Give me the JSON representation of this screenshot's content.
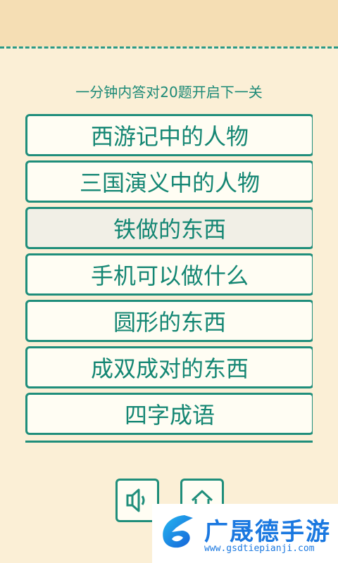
{
  "subtitle": "一分钟内答对20题开启下一关",
  "categories": [
    {
      "label": "西游记中的人物"
    },
    {
      "label": "三国演义中的人物"
    },
    {
      "label": "铁做的东西"
    },
    {
      "label": "手机可以做什么"
    },
    {
      "label": "圆形的东西"
    },
    {
      "label": "成双成对的东西"
    },
    {
      "label": "四字成语"
    }
  ],
  "controls": {
    "sound_icon": "speaker-icon",
    "home_icon": "home-icon"
  },
  "watermark": {
    "brand": "广晟德手游",
    "url": "www.gsdtiepianji.com"
  },
  "colors": {
    "accent": "#1f8e7b",
    "background": "#fbefd6",
    "header": "#f5deb4",
    "brand": "#1a78e0"
  }
}
